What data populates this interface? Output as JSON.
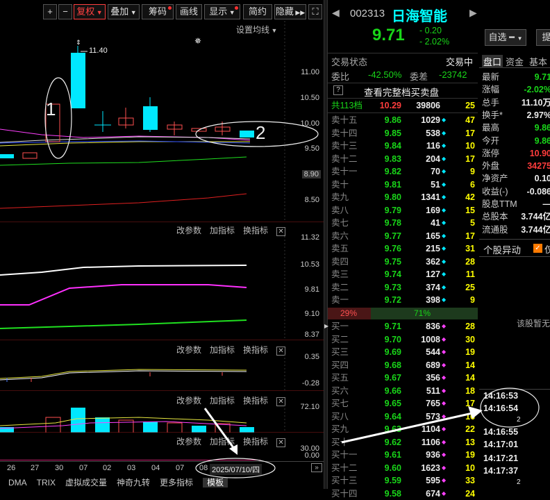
{
  "toolbar": {
    "plus": "+",
    "minus": "−",
    "fuquan": "复权",
    "diejia": "叠加",
    "chouma": "筹码",
    "huaxian": "画线",
    "xianshi": "显示",
    "jianyue": "简约",
    "yincang": "隐藏",
    "expand_icon": "⛶"
  },
  "main_pane": {
    "setting": "设置均线",
    "high_label": "11.40",
    "y_ticks": [
      "11.00",
      "10.50",
      "10.00",
      "9.50",
      "8.90",
      "8.50"
    ],
    "ann1": "1",
    "ann2": "2"
  },
  "pane2": {
    "tools": [
      "改参数",
      "加指标",
      "换指标"
    ],
    "y_ticks": [
      "11.32",
      "10.53",
      "9.81",
      "9.10",
      "8.37"
    ]
  },
  "pane3": {
    "tools": [
      "改参数",
      "加指标",
      "换指标"
    ],
    "y_ticks": [
      "0.35",
      "-0.28"
    ]
  },
  "pane4": {
    "tools": [
      "改参数",
      "加指标",
      "换指标"
    ],
    "y_ticks": [
      "72.10"
    ]
  },
  "pane5": {
    "tools": [
      "改参数",
      "加指标",
      "换指标"
    ],
    "y_ticks": [
      "30.00",
      "0.00"
    ]
  },
  "dates": [
    "26",
    "27",
    "30",
    "07",
    "02",
    "03",
    "04",
    "07",
    "08"
  ],
  "date_box": "2025/07/10/四",
  "tabs": [
    "DMA",
    "TRIX",
    "虚拟成交量",
    "神奇九转",
    "更多指标",
    "模板"
  ],
  "stock": {
    "code": "002313",
    "name": "日海智能",
    "price": "9.71",
    "change": "- 0.20",
    "pct": "- 2.02%",
    "zixuan": "自选",
    "ti": "提"
  },
  "status": {
    "label": "交易状态",
    "value": "交易中",
    "weibi_l": "委比",
    "weibi": "-42.50%",
    "weicha_l": "委差",
    "weicha": "-23742",
    "view_full": "查看完整档买卖盘",
    "q": "?"
  },
  "summary": {
    "label": "共113档",
    "price": "10.29",
    "vol": "39806",
    "cnt": "25"
  },
  "asks": [
    {
      "l": "卖十五",
      "p": "9.86",
      "v": "1029",
      "m": "◆",
      "c": "47"
    },
    {
      "l": "卖十四",
      "p": "9.85",
      "v": "538",
      "m": "◆",
      "c": "17"
    },
    {
      "l": "卖十三",
      "p": "9.84",
      "v": "116",
      "m": "◆",
      "c": "10"
    },
    {
      "l": "卖十二",
      "p": "9.83",
      "v": "204",
      "m": "◆",
      "c": "17"
    },
    {
      "l": "卖十一",
      "p": "9.82",
      "v": "70",
      "m": "◆",
      "c": "9"
    },
    {
      "l": "卖十",
      "p": "9.81",
      "v": "51",
      "m": "◆",
      "c": "6"
    },
    {
      "l": "卖九",
      "p": "9.80",
      "v": "1341",
      "m": "◆",
      "c": "42"
    },
    {
      "l": "卖八",
      "p": "9.79",
      "v": "169",
      "m": "◆",
      "c": "15"
    },
    {
      "l": "卖七",
      "p": "9.78",
      "v": "41",
      "m": "◆",
      "c": "5"
    },
    {
      "l": "卖六",
      "p": "9.77",
      "v": "165",
      "m": "◆",
      "c": "17"
    },
    {
      "l": "卖五",
      "p": "9.76",
      "v": "215",
      "m": "◆",
      "c": "31"
    },
    {
      "l": "卖四",
      "p": "9.75",
      "v": "362",
      "m": "◆",
      "c": "28"
    },
    {
      "l": "卖三",
      "p": "9.74",
      "v": "127",
      "m": "◆",
      "c": "11"
    },
    {
      "l": "卖二",
      "p": "9.73",
      "v": "374",
      "m": "◆",
      "c": "25"
    },
    {
      "l": "卖一",
      "p": "9.72",
      "v": "398",
      "m": "◆",
      "c": "9"
    }
  ],
  "ratio": {
    "left": "29%",
    "right": "71%"
  },
  "bids": [
    {
      "l": "买一",
      "p": "9.71",
      "v": "836",
      "m": "◆",
      "c": "28"
    },
    {
      "l": "买二",
      "p": "9.70",
      "v": "1008",
      "m": "◆",
      "c": "30"
    },
    {
      "l": "买三",
      "p": "9.69",
      "v": "544",
      "m": "◆",
      "c": "19"
    },
    {
      "l": "买四",
      "p": "9.68",
      "v": "689",
      "m": "◆",
      "c": "14"
    },
    {
      "l": "买五",
      "p": "9.67",
      "v": "356",
      "m": "◆",
      "c": "14"
    },
    {
      "l": "买六",
      "p": "9.66",
      "v": "511",
      "m": "◆",
      "c": "18"
    },
    {
      "l": "买七",
      "p": "9.65",
      "v": "765",
      "m": "◆",
      "c": "17"
    },
    {
      "l": "买八",
      "p": "9.64",
      "v": "573",
      "m": "◆",
      "c": "16"
    },
    {
      "l": "买九",
      "p": "9.63",
      "v": "1104",
      "m": "◆",
      "c": "22"
    },
    {
      "l": "买十",
      "p": "9.62",
      "v": "1106",
      "m": "◆",
      "c": "13"
    },
    {
      "l": "买十一",
      "p": "9.61",
      "v": "936",
      "m": "◆",
      "c": "19"
    },
    {
      "l": "买十二",
      "p": "9.60",
      "v": "1623",
      "m": "◆",
      "c": "10"
    },
    {
      "l": "买十三",
      "p": "9.59",
      "v": "595",
      "m": "◆",
      "c": "33"
    },
    {
      "l": "买十四",
      "p": "9.58",
      "v": "674",
      "m": "◆",
      "c": "24"
    }
  ],
  "side": {
    "tabs": [
      "盘口",
      "资金",
      "基本"
    ],
    "rows": [
      {
        "k": "最新",
        "v": "9.71",
        "c": "green"
      },
      {
        "k": "涨幅",
        "v": "-2.02%",
        "c": "green"
      },
      {
        "k": "总手",
        "v": "11.10万",
        "c": "white"
      },
      {
        "k": "换手*",
        "v": "2.97%",
        "c": "white"
      },
      {
        "k": "最高",
        "v": "9.86",
        "c": "green"
      },
      {
        "k": "今开",
        "v": "9.86",
        "c": "green"
      },
      {
        "k": "涨停",
        "v": "10.90",
        "c": "red"
      },
      {
        "k": "外盘",
        "v": "34275",
        "c": "red"
      },
      {
        "k": "净资产",
        "v": "0.10",
        "c": "white"
      },
      {
        "k": "收益(-)",
        "v": "-0.086",
        "c": "white"
      },
      {
        "k": "股息TTM",
        "v": "—",
        "c": "white"
      },
      {
        "k": "总股本",
        "v": "3.744亿",
        "c": "white"
      },
      {
        "k": "流通股",
        "v": "3.744亿",
        "c": "white"
      }
    ],
    "abnormal": "个股异动",
    "abnormal_chk": "仅",
    "no_data": "该股暂无",
    "ticks": [
      {
        "t": "14:16:53",
        "n": ""
      },
      {
        "t": "14:16:54",
        "n": "2"
      },
      {
        "t": "14:16:55",
        "n": ""
      },
      {
        "t": "14:17:01",
        "n": ""
      },
      {
        "t": "14:17:21",
        "n": ""
      },
      {
        "t": "14:17:37",
        "n": "2"
      }
    ]
  }
}
